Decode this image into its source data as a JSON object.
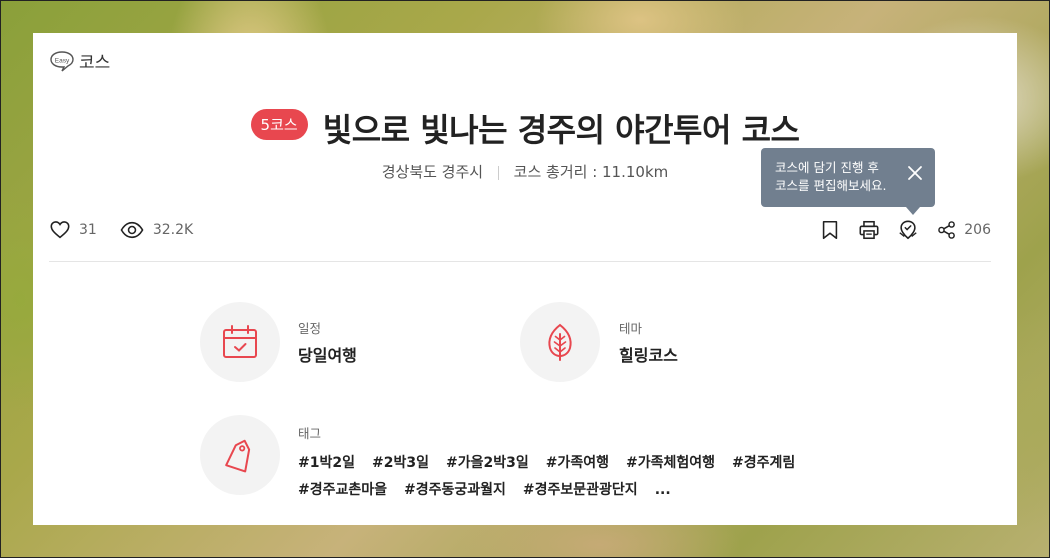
{
  "header": {
    "easy_label": "코스"
  },
  "course": {
    "badge": "5코스",
    "title": "빛으로 빛나는 경주의 야간투어 코스",
    "region": "경상북도 경주시",
    "distance": "코스 총거리 : 11.10km"
  },
  "tooltip": {
    "line1": "코스에 담기 진행 후",
    "line2": "코스를 편집해보세요."
  },
  "stats": {
    "likes": "31",
    "views": "32.2K",
    "shares": "206"
  },
  "icons": {
    "easy": "easy-speech-bubble-icon",
    "like": "heart-icon",
    "views": "eye-icon",
    "bookmark": "bookmark-icon",
    "print": "printer-icon",
    "map": "map-pin-icon",
    "share": "share-icon",
    "close": "close-icon",
    "schedule": "calendar-icon",
    "theme": "leaf-icon",
    "tags": "tag-icon"
  },
  "info": {
    "schedule_label": "일정",
    "schedule_value": "당일여행",
    "theme_label": "테마",
    "theme_value": "힐링코스",
    "tags_label": "태그"
  },
  "tags": [
    "#1박2일",
    "#2박3일",
    "#가을2박3일",
    "#가족여행",
    "#가족체험여행",
    "#경주계림",
    "#경주교촌마을",
    "#경주동궁과월지",
    "#경주보문관광단지",
    "..."
  ],
  "colors": {
    "accent": "#e8474f",
    "tooltip_bg": "#717f8f",
    "icon_red": "#e8474f"
  }
}
